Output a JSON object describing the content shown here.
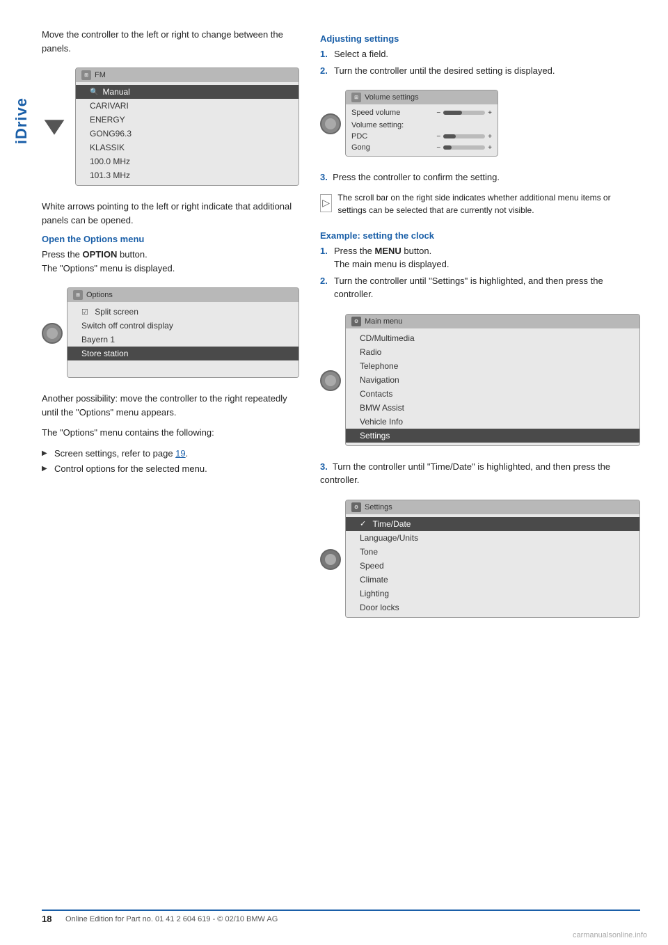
{
  "sidebar": {
    "label": "iDrive"
  },
  "left_col": {
    "intro_text": "Move the controller to the left or right to change between the panels.",
    "fm_screen": {
      "title": "FM",
      "rows": [
        "Manual",
        "CARIVARI",
        "ENERGY",
        "GONG96.3",
        "KLASSIK",
        "100.0 MHz",
        "101.3 MHz"
      ],
      "highlighted_row": 0
    },
    "white_arrows_text": "White arrows pointing to the left or right indicate that additional panels can be opened.",
    "open_options_heading": "Open the Options menu",
    "open_options_text1": "Press the",
    "open_options_bold": "OPTION",
    "open_options_text2": "button.",
    "open_options_text3": "The \"Options\" menu is displayed.",
    "options_screen": {
      "title": "Options",
      "rows": [
        "Split screen",
        "Switch off control display",
        "Bayern 1",
        "Store station"
      ],
      "checked_row": 0,
      "highlighted_row": 3
    },
    "another_text": "Another possibility: move the controller to the right repeatedly until the \"Options\" menu appears.",
    "contains_text": "The \"Options\" menu contains the following:",
    "bullets": [
      "Screen settings, refer to page 19.",
      "Control options for the selected menu."
    ]
  },
  "right_col": {
    "adjusting_heading": "Adjusting settings",
    "adjusting_steps": [
      {
        "num": "1.",
        "text": "Select a field."
      },
      {
        "num": "2.",
        "text": "Turn the controller until the desired setting is displayed."
      }
    ],
    "volume_screen": {
      "title": "Volume settings",
      "rows": [
        {
          "label": "Speed volume",
          "slider": true,
          "percent": 45
        },
        {
          "label": "Volume setting:",
          "header": true
        },
        {
          "label": "PDC",
          "slider": true,
          "percent": 30
        },
        {
          "label": "Gong",
          "slider": true,
          "percent": 20
        }
      ]
    },
    "step3_text": "Press the controller to confirm the setting.",
    "scroll_note": "The scroll bar on the right side indicates whether additional menu items or settings can be selected that are currently not visible.",
    "example_heading": "Example: setting the clock",
    "example_steps": [
      {
        "num": "1.",
        "text1": "Press the",
        "bold": "MENU",
        "text2": "button.",
        "sub": "The main menu is displayed."
      },
      {
        "num": "2.",
        "text": "Turn the controller until \"Settings\" is highlighted, and then press the controller."
      }
    ],
    "main_menu_screen": {
      "title": "Main menu",
      "rows": [
        "CD/Multimedia",
        "Radio",
        "Telephone",
        "Navigation",
        "Contacts",
        "BMW Assist",
        "Vehicle Info",
        "Settings"
      ],
      "highlighted_row": 7
    },
    "step3_clock": "Turn the controller until \"Time/Date\" is highlighted, and then press the controller.",
    "settings_screen": {
      "title": "Settings",
      "rows": [
        "Time/Date",
        "Language/Units",
        "Tone",
        "Speed",
        "Climate",
        "Lighting",
        "Door locks"
      ],
      "highlighted_row": 0,
      "checked_row": 0
    }
  },
  "footer": {
    "page_number": "18",
    "footer_text": "Online Edition for Part no. 01 41 2 604 619 - © 02/10 BMW AG"
  },
  "watermark": "carmanualsonline.info"
}
